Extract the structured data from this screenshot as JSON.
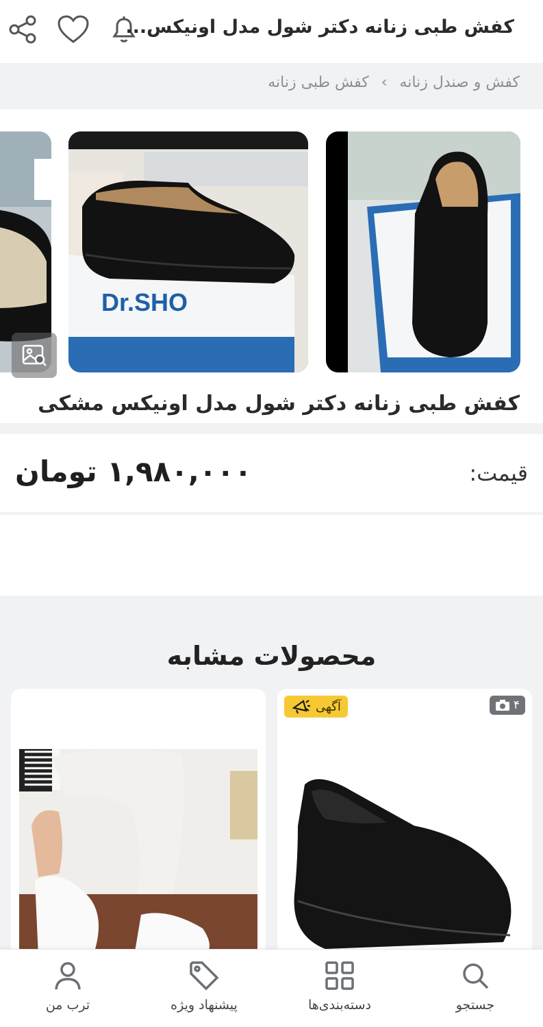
{
  "header": {
    "title": "کفش طبی زنانه دکتر شول مدل اونیکس...",
    "icons": [
      "share-icon",
      "heart-icon",
      "bell-icon"
    ]
  },
  "breadcrumb": {
    "items": [
      "کفش و صندل زنانه",
      "کفش طبی زنانه"
    ],
    "separator": "›"
  },
  "product": {
    "title": "کفش طبی زنانه دکتر شول مدل اونیکس مشکی",
    "price_label": "قیمت:",
    "price_value": "۱,۹۸۰,۰۰۰ تومان",
    "box_brand": "Dr.SHO"
  },
  "similar": {
    "title": "محصولات مشابه",
    "ad_badge": "آگهی",
    "photo_count": "۴"
  },
  "bottom_nav": {
    "items": [
      {
        "label": "جستجو",
        "icon": "search-icon"
      },
      {
        "label": "دسته‌بندی‌ها",
        "icon": "grid-icon"
      },
      {
        "label": "پیشنهاد ویژه",
        "icon": "tag-icon"
      },
      {
        "label": "ترب من",
        "icon": "user-icon"
      }
    ]
  },
  "colors": {
    "background_gray": "#f1f2f4",
    "ad_badge": "#f6c934",
    "text_dark": "#222222",
    "text_muted": "#8a8f96"
  }
}
